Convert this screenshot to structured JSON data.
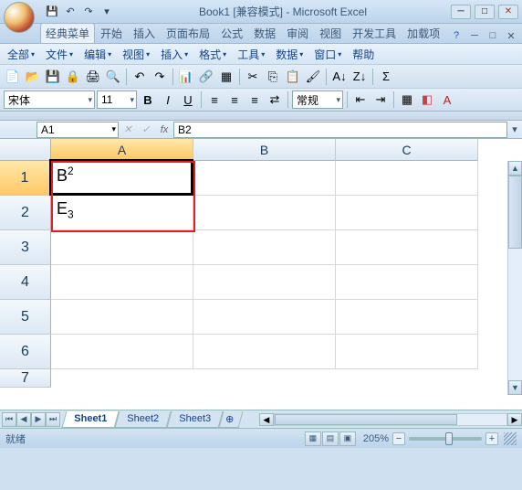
{
  "title": "Book1 [兼容模式] - Microsoft Excel",
  "qat": {
    "save": "💾",
    "undo": "↶",
    "redo": "↷"
  },
  "tabs": {
    "classic": "经典菜单",
    "home": "开始",
    "insert": "插入",
    "layout": "页面布局",
    "formulas": "公式",
    "data": "数据",
    "review": "审阅",
    "view": "视图",
    "dev": "开发工具",
    "addins": "加载项"
  },
  "menus": {
    "all": "全部",
    "file": "文件",
    "edit": "编辑",
    "view": "视图",
    "insert": "插入",
    "format": "格式",
    "tools": "工具",
    "data": "数据",
    "window": "窗口",
    "help": "帮助"
  },
  "format": {
    "font": "宋体",
    "size": "11",
    "style": "常规"
  },
  "nameBox": "A1",
  "formulaValue": "B2",
  "columns": [
    "A",
    "B",
    "C"
  ],
  "rows": [
    "1",
    "2",
    "3",
    "4",
    "5",
    "6",
    "7"
  ],
  "cells": {
    "A1": {
      "base": "B",
      "sup": "2"
    },
    "A2": {
      "base": "E",
      "sub": "3"
    }
  },
  "sheets": [
    "Sheet1",
    "Sheet2",
    "Sheet3"
  ],
  "activeSheet": 0,
  "status": {
    "ready": "就绪",
    "zoom": "205%"
  }
}
